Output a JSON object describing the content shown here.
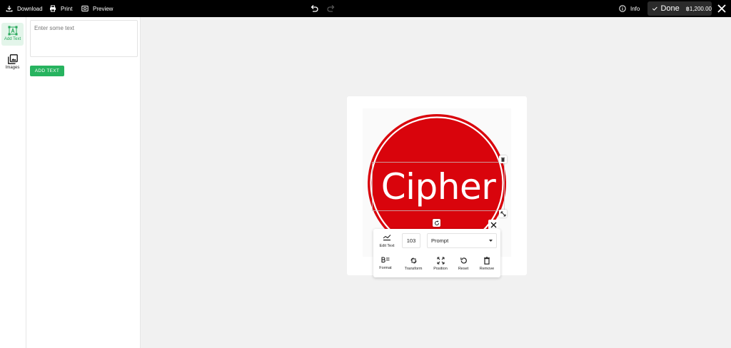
{
  "topbar": {
    "download_label": "Download",
    "print_label": "Print",
    "preview_label": "Preview",
    "info_label": "Info",
    "done_label": "Done",
    "price": "฿1,200.00"
  },
  "rail": {
    "items": [
      {
        "label": "Add Text",
        "icon": "add-text-icon",
        "active": true
      },
      {
        "label": "Images",
        "icon": "images-icon",
        "active": false
      }
    ]
  },
  "panel": {
    "text_placeholder": "Enter some text",
    "add_button": "ADD TEXT"
  },
  "canvas": {
    "logo_text": "Cipher",
    "logo_color": "#d9040c"
  },
  "text_toolbar": {
    "edit_text_label": "Edit Text",
    "font_size": "103",
    "font_name": "Prompt",
    "format_label": "Format",
    "transform_label": "Transform",
    "position_label": "Position",
    "reset_label": "Reset",
    "remove_label": "Remove"
  },
  "colors": {
    "accent": "#27b35f",
    "topbar": "#000000",
    "logo_red": "#d9040c"
  }
}
